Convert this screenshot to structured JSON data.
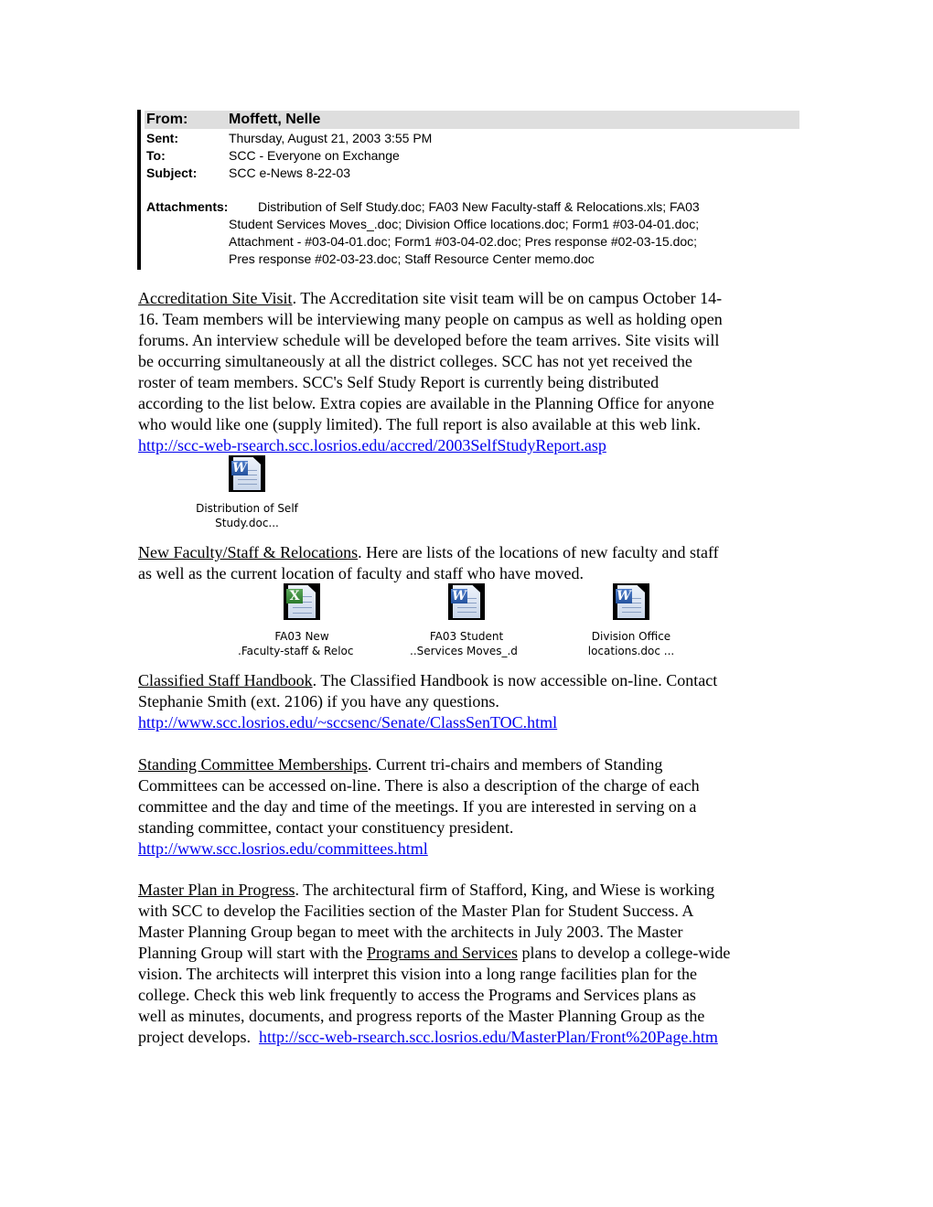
{
  "email_header": {
    "from_label": "From:",
    "from_value": "Moffett, Nelle",
    "sent_label": "Sent:",
    "sent_value": "Thursday, August 21, 2003 3:55 PM",
    "to_label": "To:",
    "to_value": "SCC - Everyone on Exchange",
    "subject_label": "Subject:",
    "subject_value": "SCC e-News 8-22-03",
    "attachments_label": "Attachments:",
    "attachments_lines": [
      "Distribution of Self Study.doc; FA03 New Faculty-staff & Relocations.xls; FA03",
      "Student Services Moves_.doc; Division Office locations.doc; Form1 #03-04-01.doc;",
      "Attachment - #03-04-01.doc; Form1 #03-04-02.doc; Pres response #02-03-15.doc;",
      "Pres response #02-03-23.doc; Staff Resource Center memo.doc"
    ]
  },
  "sections": {
    "accreditation": {
      "heading": "Accreditation Site Visit",
      "lines": [
        ".  The Accreditation site visit team will be on campus October 14-",
        "16.  Team members will be interviewing many people on campus as well as holding open",
        "forums.  An interview schedule will be developed before the team arrives.  Site visits will",
        "be occurring simultaneously at all the district colleges.  SCC has not yet received the",
        "roster of team members.  SCC's Self Study Report is currently being distributed",
        "according to the list below.  Extra copies are available in the Planning Office for anyone",
        "who would like one (supply limited).  The full report is also available at this web link."
      ],
      "url": "http://scc-web-rsearch.scc.losrios.edu/accred/2003SelfStudyReport.asp",
      "attachments": [
        {
          "icon": "word-document-icon",
          "line1": "Distribution of Self",
          "line2": "Study.doc..."
        }
      ]
    },
    "new_faculty": {
      "heading": "New Faculty/Staff & Relocations",
      "lines": [
        ".  Here are lists of the locations of new faculty and staff",
        "as well as the current location of faculty and staff who have moved."
      ],
      "attachments": [
        {
          "icon": "excel-spreadsheet-icon",
          "line1": "FA03 New",
          "line2": "Faculty-staff & Reloc."
        },
        {
          "icon": "word-document-icon",
          "line1": "FA03 Student",
          "line2": "Services Moves_.d.."
        },
        {
          "icon": "word-document-icon",
          "line1": "Division Office",
          "line2": "locations.doc ..."
        }
      ]
    },
    "classified_handbook": {
      "heading": "Classified Staff Handbook",
      "lines": [
        ".  The Classified Handbook is now accessible on-line. Contact",
        "Stephanie Smith (ext. 2106) if you have any questions."
      ],
      "url": "http://www.scc.losrios.edu/~sccsenc/Senate/ClassSenTOC.html"
    },
    "standing_committee": {
      "heading": "Standing Committee Memberships",
      "lines": [
        ".  Current tri-chairs and members of Standing",
        "Committees can be accessed on-line.  There is also a description of the charge of each",
        "committee and the day and time of the meetings.  If you are interested in serving on a",
        "standing committee, contact your constituency president."
      ],
      "url": "http://www.scc.losrios.edu/committees.html"
    },
    "master_plan": {
      "heading": "Master Plan in Progress",
      "line1_rest": ".  The architectural firm of Stafford, King, and Wiese is working",
      "line2": "with SCC to develop the Facilities section of the Master Plan for Student Success.  A",
      "line3": "Master Planning Group began to meet with the architects in July 2003.  The Master",
      "line4_pre": "Planning Group will start with the ",
      "line4_link": "Programs and Services",
      "line4_post": " plans to develop a college-wide",
      "line5": "vision.  The architects will interpret this vision into a long range facilities plan for the",
      "line6": "college.  Check this web link frequently to access the Programs and Services plans as",
      "line7": "well as minutes, documents, and progress reports of the Master Planning Group as the",
      "line8_pre": "project develops.  ",
      "url": "http://scc-web-rsearch.scc.losrios.edu/MasterPlan/Front%20Page.htm"
    }
  },
  "colors": {
    "link": "#0000ee",
    "header_from_bg": "#dedede"
  }
}
